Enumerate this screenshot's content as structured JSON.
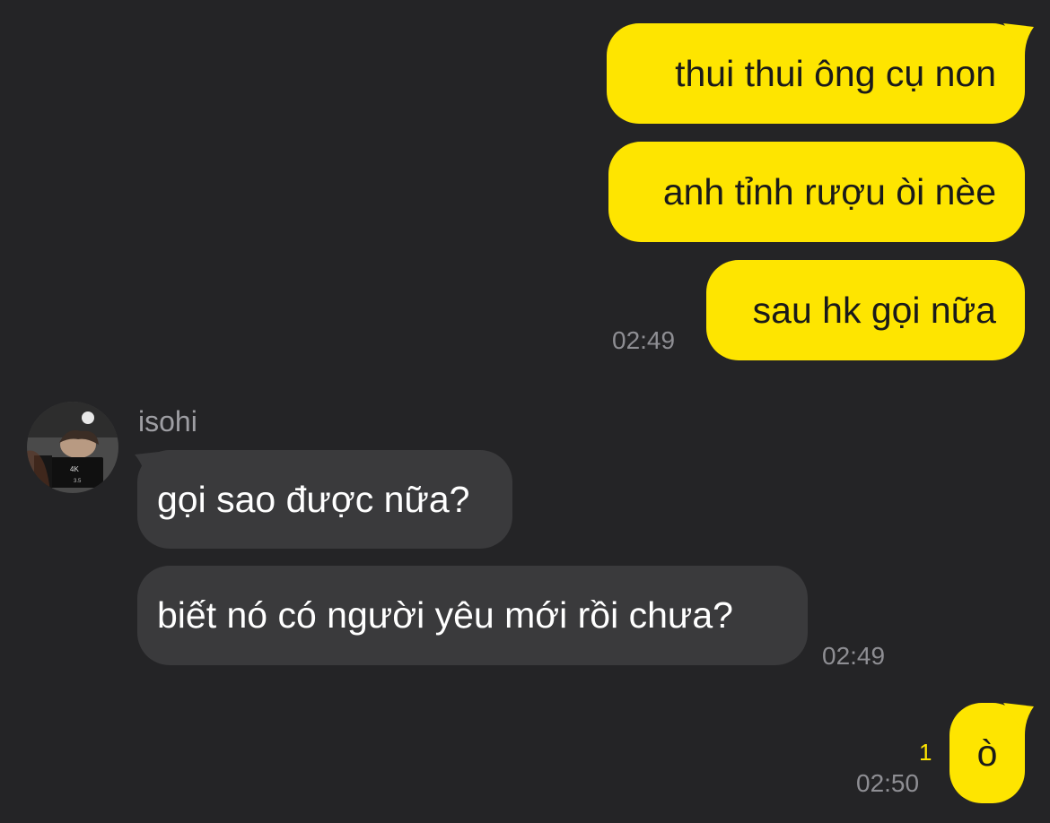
{
  "messages": [
    {
      "direction": "outgoing",
      "text": "thui thui ông cụ non"
    },
    {
      "direction": "outgoing",
      "text": "anh tỉnh rượu òi nèe"
    },
    {
      "direction": "outgoing",
      "text": "sau hk gọi nữa",
      "time": "02:49"
    },
    {
      "direction": "incoming",
      "sender": "isohi",
      "text": "gọi sao được nữa?"
    },
    {
      "direction": "incoming",
      "text": "biết nó có người yêu mới rồi chưa?",
      "time": "02:49"
    },
    {
      "direction": "outgoing",
      "text": "ò",
      "time": "02:50",
      "unread": "1"
    }
  ],
  "colors": {
    "background": "#242426",
    "outgoing_bubble": "#fee500",
    "incoming_bubble": "#3a3a3c",
    "timestamp": "#8e8e93",
    "unread_counter": "#fee500"
  }
}
